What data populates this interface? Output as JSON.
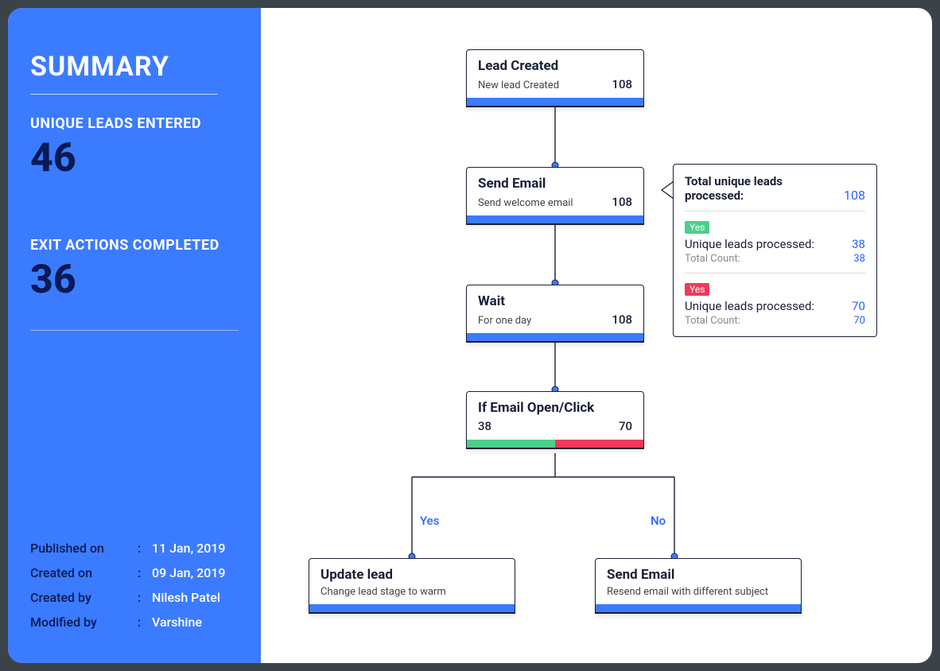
{
  "sidebar": {
    "title": "SUMMARY",
    "stat1_label": "UNIQUE LEADS ENTERED",
    "stat1_value": "46",
    "stat2_label": "EXIT ACTIONS COMPLETED",
    "stat2_value": "36",
    "meta": {
      "published_on_label": "Published on",
      "published_on_value": "11 Jan, 2019",
      "created_on_label": "Created on",
      "created_on_value": "09 Jan, 2019",
      "created_by_label": "Created by",
      "created_by_value": "Nilesh Patel",
      "modified_by_label": "Modified by",
      "modified_by_value": "Varshine",
      "colon": ":"
    }
  },
  "nodes": {
    "lead_created": {
      "title": "Lead Created",
      "subtitle": "New lead Created",
      "count": "108"
    },
    "send_email": {
      "title": "Send Email",
      "subtitle": "Send welcome email",
      "count": "108"
    },
    "wait": {
      "title": "Wait",
      "subtitle": "For one day",
      "count": "108"
    },
    "if_open": {
      "title": "If Email Open/Click",
      "yes_count": "38",
      "no_count": "70"
    },
    "update_lead": {
      "title": "Update lead",
      "subtitle": "Change lead stage to warm"
    },
    "resend_email": {
      "title": "Send Email",
      "subtitle": "Resend email with different subject"
    }
  },
  "branches": {
    "yes": "Yes",
    "no": "No"
  },
  "tooltip": {
    "total_label": "Total unique leads processed:",
    "total_value": "108",
    "group_yes_badge": "Yes",
    "group_yes_label": "Unique leads processed:",
    "group_yes_value": "38",
    "group_yes_count_label": "Total Count:",
    "group_yes_count_value": "38",
    "group_no_badge": "Yes",
    "group_no_label": "Unique leads processed:",
    "group_no_value": "70",
    "group_no_count_label": "Total Count:",
    "group_no_count_value": "70"
  }
}
